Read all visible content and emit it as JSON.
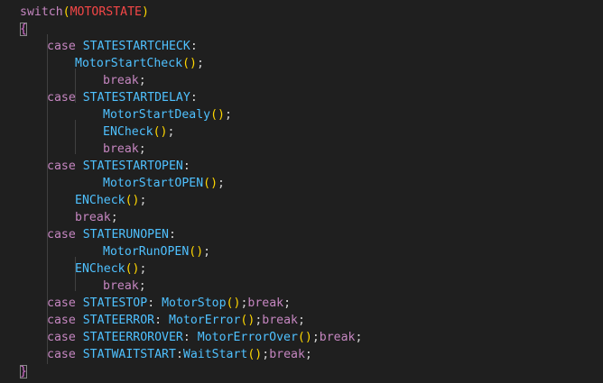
{
  "editor": {
    "lines": [
      {
        "id": "l1",
        "tokens": [
          [
            "kw",
            "switch"
          ],
          [
            "paren",
            "("
          ],
          [
            "macro",
            "MOTORSTATE"
          ],
          [
            "paren",
            ")"
          ]
        ]
      },
      {
        "id": "l2",
        "tokens": [
          [
            "brace",
            "{"
          ]
        ]
      },
      {
        "id": "l3",
        "tokens": [
          [
            "case",
            "case"
          ],
          [
            "sym",
            " "
          ],
          [
            "label",
            "STATESTARTCHECK"
          ],
          [
            "sym",
            ":"
          ]
        ]
      },
      {
        "id": "l4",
        "tokens": [
          [
            "fn",
            "MotorStartCheck"
          ],
          [
            "paren",
            "()"
          ],
          [
            "sym",
            ";"
          ]
        ]
      },
      {
        "id": "l5",
        "tokens": [
          [
            "break",
            "break"
          ],
          [
            "sym",
            ";"
          ]
        ]
      },
      {
        "id": "l6",
        "tokens": [
          [
            "case",
            "case"
          ],
          [
            "sym",
            " "
          ],
          [
            "label",
            "STATESTARTDELAY"
          ],
          [
            "sym",
            ":"
          ]
        ]
      },
      {
        "id": "l7",
        "tokens": [
          [
            "fn",
            "MotorStartDealy"
          ],
          [
            "paren",
            "()"
          ],
          [
            "sym",
            ";"
          ]
        ]
      },
      {
        "id": "l8",
        "tokens": [
          [
            "fn",
            "ENCheck"
          ],
          [
            "paren",
            "()"
          ],
          [
            "sym",
            ";"
          ]
        ]
      },
      {
        "id": "l9",
        "tokens": [
          [
            "break",
            "break"
          ],
          [
            "sym",
            ";"
          ]
        ]
      },
      {
        "id": "l10",
        "tokens": [
          [
            "case",
            "case"
          ],
          [
            "sym",
            " "
          ],
          [
            "label",
            "STATESTARTOPEN"
          ],
          [
            "sym",
            ":"
          ]
        ]
      },
      {
        "id": "l11",
        "tokens": [
          [
            "fn",
            "MotorStartOPEN"
          ],
          [
            "paren",
            "()"
          ],
          [
            "sym",
            ";"
          ]
        ]
      },
      {
        "id": "l12",
        "tokens": [
          [
            "fn",
            "ENCheck"
          ],
          [
            "paren",
            "()"
          ],
          [
            "sym",
            ";"
          ]
        ]
      },
      {
        "id": "l13",
        "tokens": [
          [
            "break",
            "break"
          ],
          [
            "sym",
            ";"
          ]
        ]
      },
      {
        "id": "l14",
        "tokens": [
          [
            "case",
            "case"
          ],
          [
            "sym",
            " "
          ],
          [
            "label",
            "STATERUNOPEN"
          ],
          [
            "sym",
            ":"
          ]
        ]
      },
      {
        "id": "l15",
        "tokens": [
          [
            "fn",
            "MotorRunOPEN"
          ],
          [
            "paren",
            "()"
          ],
          [
            "sym",
            ";"
          ]
        ]
      },
      {
        "id": "l16",
        "tokens": [
          [
            "fn",
            "ENCheck"
          ],
          [
            "paren",
            "()"
          ],
          [
            "sym",
            ";"
          ]
        ]
      },
      {
        "id": "l17",
        "tokens": [
          [
            "break",
            "break"
          ],
          [
            "sym",
            ";"
          ]
        ]
      },
      {
        "id": "l18",
        "tokens": [
          [
            "case",
            "case"
          ],
          [
            "sym",
            " "
          ],
          [
            "label",
            "STATESTOP"
          ],
          [
            "sym",
            ": "
          ],
          [
            "fn",
            "MotorStop"
          ],
          [
            "paren",
            "()"
          ],
          [
            "sym",
            ";"
          ],
          [
            "break",
            "break"
          ],
          [
            "sym",
            ";"
          ]
        ]
      },
      {
        "id": "l19",
        "tokens": [
          [
            "case",
            "case"
          ],
          [
            "sym",
            " "
          ],
          [
            "label",
            "STATEERROR"
          ],
          [
            "sym",
            ": "
          ],
          [
            "fn",
            "MotorError"
          ],
          [
            "paren",
            "()"
          ],
          [
            "sym",
            ";"
          ],
          [
            "break",
            "break"
          ],
          [
            "sym",
            ";"
          ]
        ]
      },
      {
        "id": "l20",
        "tokens": [
          [
            "case",
            "case"
          ],
          [
            "sym",
            " "
          ],
          [
            "label",
            "STATEERROROVER"
          ],
          [
            "sym",
            ": "
          ],
          [
            "fn",
            "MotorErrorOver"
          ],
          [
            "paren",
            "()"
          ],
          [
            "sym",
            ";"
          ],
          [
            "break",
            "break"
          ],
          [
            "sym",
            ";"
          ]
        ]
      },
      {
        "id": "l21",
        "tokens": [
          [
            "case",
            "case"
          ],
          [
            "sym",
            " "
          ],
          [
            "label",
            "STATWAITSTART"
          ],
          [
            "sym",
            ":"
          ],
          [
            "fn",
            "WaitStart"
          ],
          [
            "paren",
            "()"
          ],
          [
            "sym",
            ";"
          ],
          [
            "break",
            "break"
          ],
          [
            "sym",
            ";"
          ]
        ]
      },
      {
        "id": "l22",
        "tokens": [
          [
            "brace",
            "}"
          ]
        ]
      }
    ]
  },
  "colors": {
    "background": "#1f1f1f",
    "keyword": "#c586c0",
    "function": "#4fc1ff",
    "paren": "#ffd700",
    "macro": "#f44747",
    "plain": "#d4d4d4",
    "brace": "#da70d6"
  }
}
